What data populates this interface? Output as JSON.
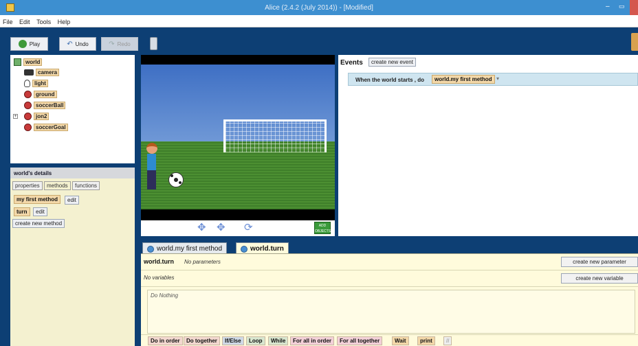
{
  "window": {
    "title": "Alice (2.4.2 (July 2014)) - [Modified]",
    "minimize": "–",
    "maximize": "▭"
  },
  "menu": [
    "File",
    "Edit",
    "Tools",
    "Help"
  ],
  "toolbar": {
    "play": "Play",
    "undo": "Undo",
    "redo": "Redo"
  },
  "tree": {
    "root": "world",
    "items": [
      "camera",
      "light",
      "ground",
      "soccerBall",
      "jon2",
      "soccerGoal"
    ]
  },
  "details": {
    "title": "world's details",
    "tabs": [
      "properties",
      "methods",
      "functions"
    ],
    "methods": [
      {
        "name": "my first method",
        "edit": "edit"
      },
      {
        "name": "turn",
        "edit": "edit"
      }
    ],
    "create_method": "create new method"
  },
  "scene": {
    "add_objects": "ADD OBJECTS"
  },
  "events": {
    "label": "Events",
    "create_event": "create new event",
    "event_text": "When the world starts , do",
    "event_method": "world.my first method"
  },
  "editor": {
    "tabs": [
      "world.my first method",
      "world.turn"
    ],
    "method_name": "world.turn",
    "no_params": "No parameters",
    "no_vars": "No variables",
    "do_nothing": "Do Nothing",
    "create_param": "create new parameter",
    "create_var": "create new variable"
  },
  "controls": [
    "Do in order",
    "Do together",
    "If/Else",
    "Loop",
    "While",
    "For all in order",
    "For all together",
    "Wait",
    "print",
    "//"
  ]
}
